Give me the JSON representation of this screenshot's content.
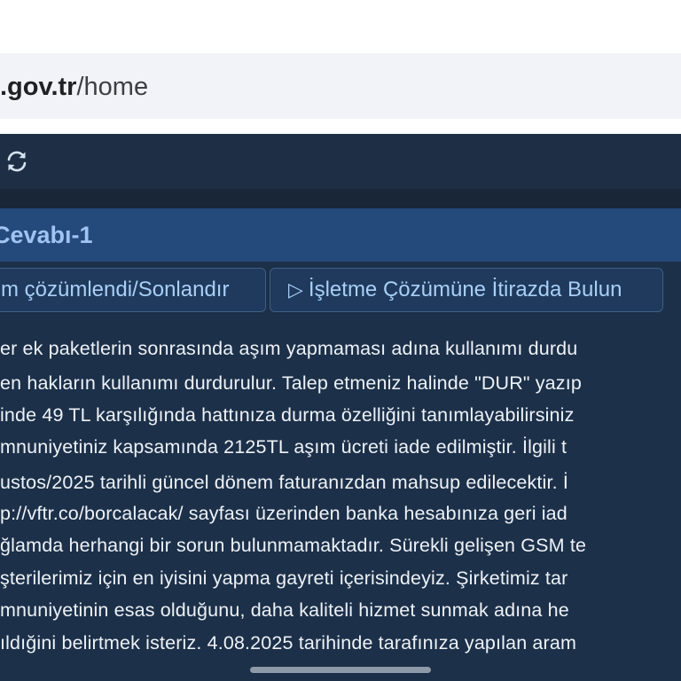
{
  "browser": {
    "url_host": ".gov.tr",
    "url_path": "/home"
  },
  "toolbar": {
    "refresh_icon": "refresh-icon"
  },
  "panel": {
    "title": "Cevabı-1",
    "buttons": [
      {
        "label": "m çözümlendi/Sonlandır"
      },
      {
        "icon": "▷",
        "label": "İşletme Çözümüne İtirazda Bulun"
      }
    ]
  },
  "message": {
    "lines": [
      "er ek paketlerin sonrasında aşım yapmaması adına kullanımı durdu",
      "en hakların kullanımı durdurulur. Talep etmeniz halinde \"DUR\" yazıp",
      "inde 49 TL karşılığında hattınıza durma özelliğini tanımlayabilirsiniz",
      "mnuniyetiniz kapsamında 2125TL aşım ücreti iade edilmiştir. İlgili t",
      "ustos/2025 tarihli güncel dönem faturanızdan mahsup edilecektir. İ",
      "p://vftr.co/borcalacak/ sayfası üzerinden banka hesabınıza geri iad",
      "ğlamda herhangi bir sorun bulunmamaktadır. Sürekli gelişen GSM te",
      "şterilerimiz için en iyisini yapma gayreti içerisindeyiz. Şirketimiz tar",
      "mnuniyetinin esas olduğunu, daha kaliteli hizmet sunmak adına he",
      "ıldığini belirtmek isteriz. 4.08.2025 tarihinde tarafınıza yapılan aram"
    ]
  }
}
